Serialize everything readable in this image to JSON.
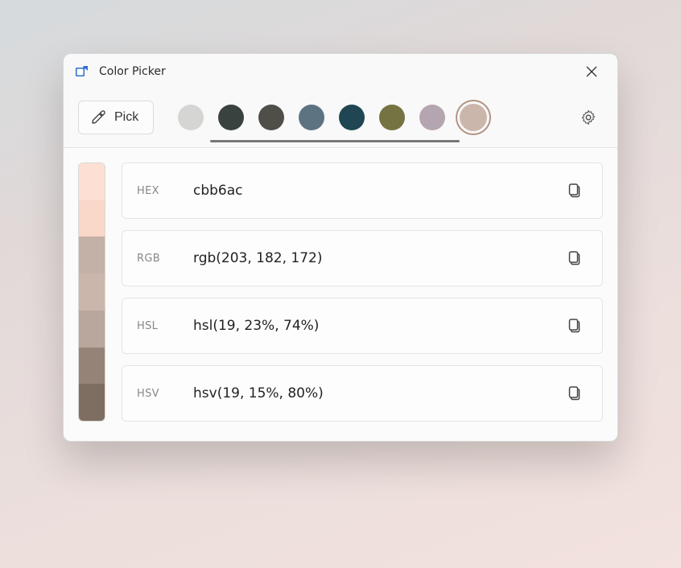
{
  "app": {
    "title": "Color Picker"
  },
  "toolbar": {
    "pick_label": "Pick",
    "swatches": [
      {
        "color": "#d5d5d4",
        "selected": false
      },
      {
        "color": "#3a4240",
        "selected": false
      },
      {
        "color": "#4f4e48",
        "selected": false
      },
      {
        "color": "#5e7382",
        "selected": false
      },
      {
        "color": "#1f4652",
        "selected": false
      },
      {
        "color": "#757341",
        "selected": false
      },
      {
        "color": "#b4a5b0",
        "selected": false
      },
      {
        "color": "#cbb6ac",
        "selected": true
      }
    ]
  },
  "shades": [
    "#fde0d3",
    "#f9d7c9",
    "#c3b0a6",
    "#cbb6ac",
    "#b9a69c",
    "#958377",
    "#7e6e62"
  ],
  "formats": [
    {
      "label": "HEX",
      "value": "cbb6ac"
    },
    {
      "label": "RGB",
      "value": "rgb(203, 182, 172)"
    },
    {
      "label": "HSL",
      "value": "hsl(19, 23%, 74%)"
    },
    {
      "label": "HSV",
      "value": "hsv(19, 15%, 80%)"
    }
  ]
}
